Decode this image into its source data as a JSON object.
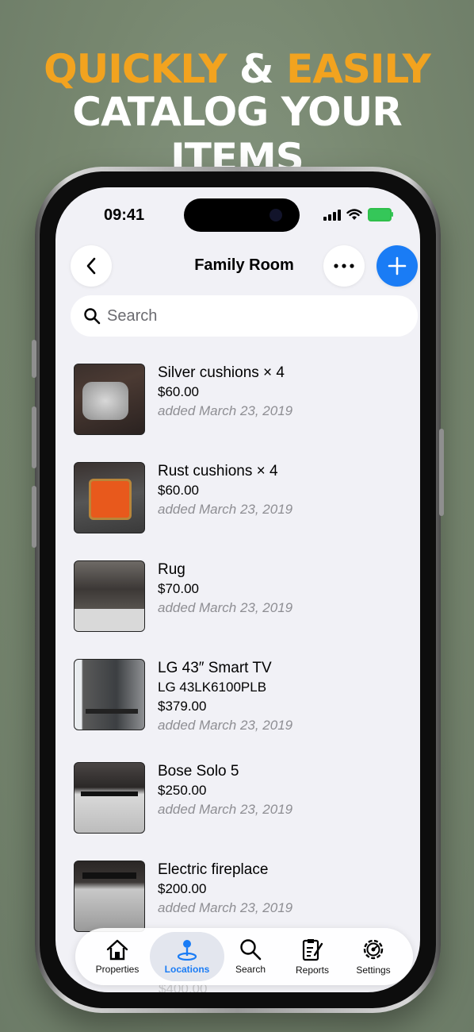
{
  "headline": {
    "line1_part1": "QUICKLY",
    "line1_amp": "&",
    "line1_part2": "EASILY",
    "line2": "CATALOG YOUR ITEMS"
  },
  "status_bar": {
    "time": "09:41",
    "icons": [
      "signal-icon",
      "wifi-icon",
      "battery-charging-icon"
    ]
  },
  "nav": {
    "title": "Family Room",
    "back_icon": "chevron-left-icon",
    "more_icon": "ellipsis-icon",
    "add_icon": "plus-icon"
  },
  "search": {
    "placeholder": "Search",
    "icon": "search-icon"
  },
  "items": [
    {
      "name": "Silver cushions × 4",
      "price": "$60.00",
      "date": "added March 23, 2019"
    },
    {
      "name": "Rust cushions × 4",
      "price": "$60.00",
      "date": "added March 23, 2019"
    },
    {
      "name": "Rug",
      "price": "$70.00",
      "date": "added March 23, 2019"
    },
    {
      "name": "LG 43″ Smart TV",
      "model": "LG 43LK6100PLB",
      "price": "$379.00",
      "date": "added March 23, 2019"
    },
    {
      "name": "Bose Solo 5",
      "price": "$250.00",
      "date": "added March 23, 2019"
    },
    {
      "name": "Electric fireplace",
      "price": "$200.00",
      "date": "added March 23, 2019"
    }
  ],
  "partial_item_price": "$400.00",
  "tabbar": {
    "tabs": [
      {
        "label": "Properties",
        "icon": "house-icon"
      },
      {
        "label": "Locations",
        "icon": "map-pin-icon",
        "active": true
      },
      {
        "label": "Search",
        "icon": "search-icon"
      },
      {
        "label": "Reports",
        "icon": "report-icon"
      },
      {
        "label": "Settings",
        "icon": "gear-icon"
      }
    ]
  },
  "colors": {
    "accent": "#1a7cf5",
    "headline_orange": "#f2a31f",
    "background": "#7a8a74"
  }
}
